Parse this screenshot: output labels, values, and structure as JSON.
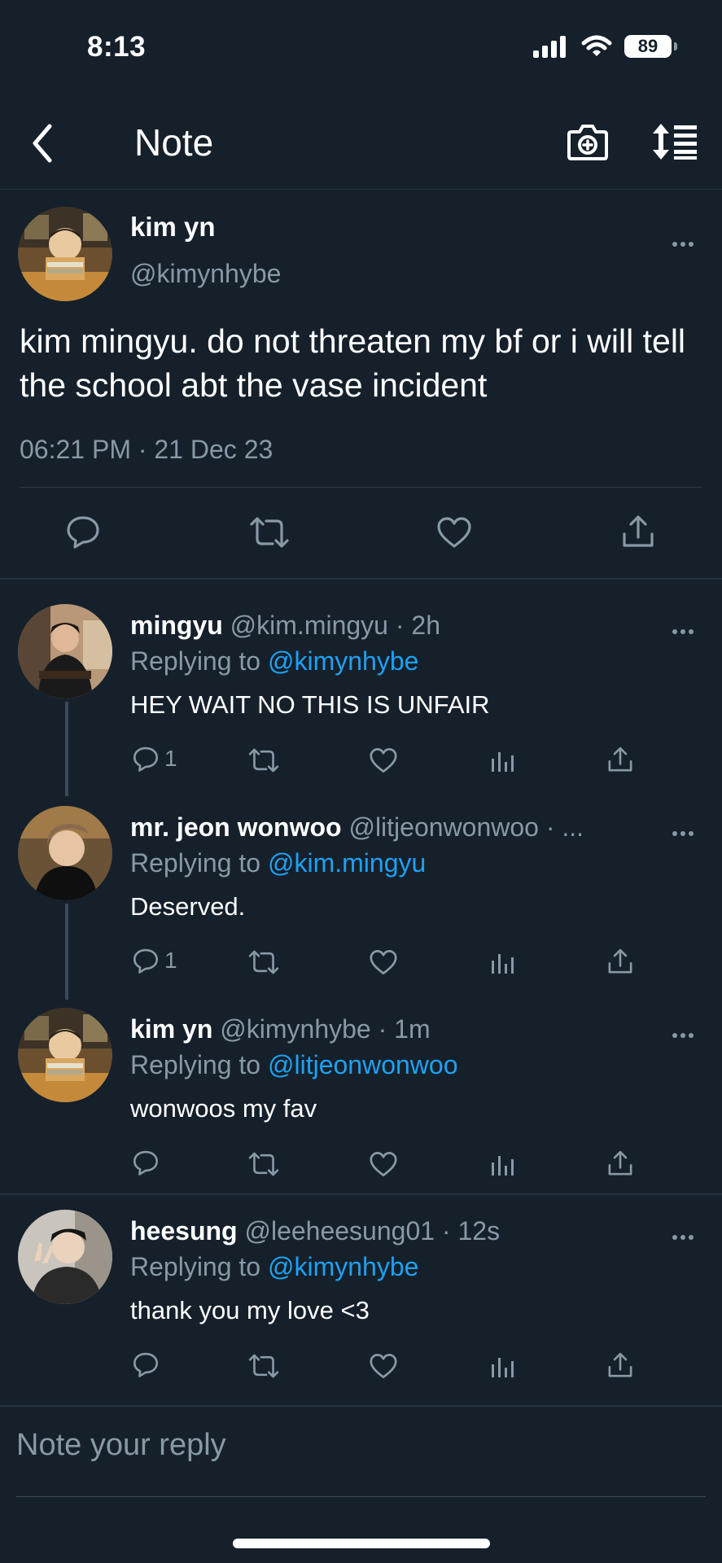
{
  "status": {
    "time": "8:13",
    "battery": "89"
  },
  "nav": {
    "title": "Note"
  },
  "main_tweet": {
    "name": "kim yn",
    "handle": "@kimynhybe",
    "text": "kim mingyu. do not threaten my bf or i will tell the school abt the vase incident",
    "time": "06:21 PM",
    "date": "21 Dec 23",
    "meta": "06:21 PM · 21 Dec 23"
  },
  "replies": [
    {
      "name": "mingyu",
      "handle_time": "@kim.mingyu · 2h",
      "replying_prefix": "Replying to ",
      "replying_to": "@kimynhybe",
      "text": "HEY WAIT NO THIS IS UNFAIR",
      "reply_count": "1"
    },
    {
      "name": "mr. jeon wonwoo",
      "handle_time": "@litjeonwonwoo · ...",
      "replying_prefix": "Replying to ",
      "replying_to": "@kim.mingyu",
      "text": "Deserved.",
      "reply_count": "1"
    },
    {
      "name": "kim yn",
      "handle_time": "@kimynhybe · 1m",
      "replying_prefix": "Replying to ",
      "replying_to": "@litjeonwonwoo",
      "text": "wonwoos my fav",
      "reply_count": ""
    },
    {
      "name": "heesung",
      "handle_time": "@leeheesung01 · 12s",
      "replying_prefix": "Replying to ",
      "replying_to": "@kimynhybe",
      "text": "thank you my love <3",
      "reply_count": ""
    }
  ],
  "composer": {
    "placeholder": "Note your reply"
  },
  "colors": {
    "background": "#15202b",
    "secondary_text": "#8899a6",
    "link": "#1da1f2"
  },
  "icons": [
    "back-icon",
    "camera-plus-icon",
    "sort-icon",
    "more-icon",
    "reply-icon",
    "retweet-icon",
    "like-icon",
    "share-icon",
    "analytics-icon"
  ]
}
